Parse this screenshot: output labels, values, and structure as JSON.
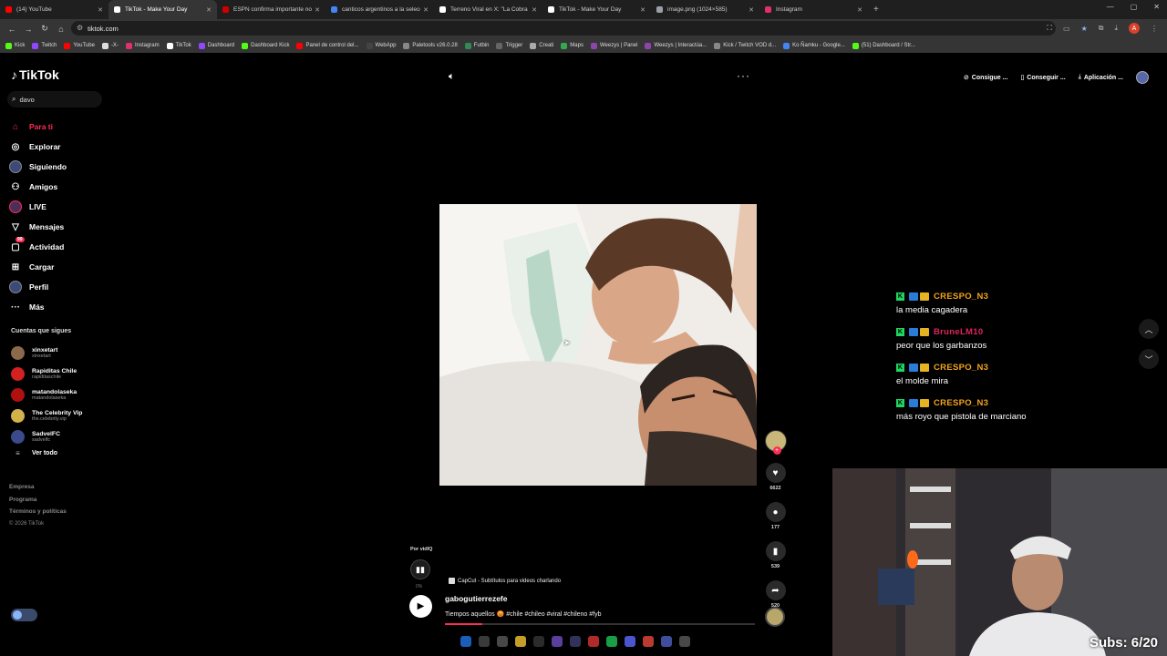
{
  "browser": {
    "tabs": [
      {
        "label": "(14) YouTube",
        "color": "#ff0000",
        "active": false
      },
      {
        "label": "TikTok - Make Your Day",
        "color": "#ffffff",
        "active": true
      },
      {
        "label": "ESPN confirma importante no",
        "color": "#d00000",
        "active": false
      },
      {
        "label": "canticos argentinos a la selecci",
        "color": "#4285f4",
        "active": false
      },
      {
        "label": "Terreno Viral en X: \"La Cobra se",
        "color": "#ffffff",
        "active": false
      },
      {
        "label": "TikTok - Make Your Day",
        "color": "#ffffff",
        "active": false
      },
      {
        "label": "image.png (1024×585)",
        "color": "#9aa0a6",
        "active": false
      },
      {
        "label": "Instagram",
        "color": "#e1306c",
        "active": false
      }
    ],
    "url": "tiktok.com",
    "profile_initial": "A",
    "bookmarks": [
      {
        "label": "Kick",
        "color": "#53fc18"
      },
      {
        "label": "Twitch",
        "color": "#9146ff"
      },
      {
        "label": "YouTube",
        "color": "#ff0000"
      },
      {
        "label": "-X-",
        "color": "#dddddd"
      },
      {
        "label": "Instagram",
        "color": "#e1306c"
      },
      {
        "label": "TikTok",
        "color": "#ffffff"
      },
      {
        "label": "Dashboard",
        "color": "#9146ff"
      },
      {
        "label": "Dashboard Kick",
        "color": "#53fc18"
      },
      {
        "label": "Panel de control del...",
        "color": "#ff0000"
      },
      {
        "label": "WebApp",
        "color": "#444444"
      },
      {
        "label": "Paletools v26.0.28",
        "color": "#888888"
      },
      {
        "label": "Futbin",
        "color": "#2e8b57"
      },
      {
        "label": "Trigger",
        "color": "#666666"
      },
      {
        "label": "Creati",
        "color": "#aaaaaa"
      },
      {
        "label": "Maps",
        "color": "#34a853"
      },
      {
        "label": "Weezys | Panel",
        "color": "#8e44ad"
      },
      {
        "label": "Weezys | Interactúa...",
        "color": "#8e44ad"
      },
      {
        "label": "Kick / Twitch VOD d...",
        "color": "#888888"
      },
      {
        "label": "Ko Ñamku - Google...",
        "color": "#4285f4"
      },
      {
        "label": "(51) Dashboard / Str...",
        "color": "#53fc18"
      }
    ]
  },
  "tiktok": {
    "logo": "TikTok",
    "search_value": "davo",
    "nav": [
      {
        "label": "Para ti",
        "icon": "home-icon",
        "glyph": "⌂",
        "active": true
      },
      {
        "label": "Explorar",
        "icon": "compass-icon",
        "glyph": "◎",
        "active": false
      },
      {
        "label": "Siguiendo",
        "icon": "following-avatar",
        "glyph": "",
        "active": false
      },
      {
        "label": "Amigos",
        "icon": "friends-icon",
        "glyph": "⚇",
        "active": false
      },
      {
        "label": "LIVE",
        "icon": "live-avatar",
        "glyph": "",
        "active": false
      },
      {
        "label": "Mensajes",
        "icon": "messages-icon",
        "glyph": "▽",
        "active": false
      },
      {
        "label": "Actividad",
        "icon": "activity-icon",
        "glyph": "▢",
        "active": false,
        "badge": "99"
      },
      {
        "label": "Cargar",
        "icon": "upload-icon",
        "glyph": "⊞",
        "active": false
      },
      {
        "label": "Perfil",
        "icon": "profile-avatar",
        "glyph": "",
        "active": false
      },
      {
        "label": "Más",
        "icon": "more-icon",
        "glyph": "···",
        "active": false
      }
    ],
    "following_title": "Cuentas que sigues",
    "following": [
      {
        "name": "xinxetart",
        "handle": "xinxetart",
        "color": "#8a6a4a"
      },
      {
        "name": "Rapiditas Chile",
        "handle": "rapiditaschile",
        "color": "#d32020"
      },
      {
        "name": "matandolaseka",
        "handle": "matandolaseka",
        "color": "#b01010"
      },
      {
        "name": "The Celebrity Vip",
        "handle": "the.celebrity.vip",
        "color": "#d4b24a"
      },
      {
        "name": "SadvelFC",
        "handle": "sadvelfc",
        "color": "#3a4a8a"
      }
    ],
    "see_all": "Ver todo",
    "footer": [
      "Empresa",
      "Programa",
      "Términos y políticas"
    ],
    "copyright": "© 2026 TikTok",
    "top_buttons": [
      {
        "label": "Consigue ...",
        "icon": "coin-icon",
        "glyph": "⊘"
      },
      {
        "label": "Conseguir ...",
        "icon": "phone-icon",
        "glyph": "▯"
      },
      {
        "label": "Aplicación ...",
        "icon": "download-icon",
        "glyph": "⤓"
      }
    ],
    "video": {
      "vidiq_label": "Por vidIQ",
      "vidiq_pct": "0%",
      "capcut": "CapCut - Subtítulos para videos charlando",
      "author": "gabogutierrezefe",
      "caption": "Tiempos aquellos 😡 #chile #chileo #viral #chileno #fyb",
      "progress": 0.12
    },
    "actions": {
      "likes": "6622",
      "comments": "177",
      "saves": "539",
      "shares": "520"
    }
  },
  "stream": {
    "chat": [
      {
        "user": "CRESPO_N3",
        "color": "#f2a31b",
        "text": "la media cagadera"
      },
      {
        "user": "BruneLM10",
        "color": "#e0245e",
        "text": "peor que los garbanzos"
      },
      {
        "user": "CRESPO_N3",
        "color": "#f2a31b",
        "text": "el molde mira"
      },
      {
        "user": "CRESPO_N3",
        "color": "#f2a31b",
        "text": "más royo que pistola de marciano"
      }
    ],
    "subs": "Subs: 6/20"
  }
}
